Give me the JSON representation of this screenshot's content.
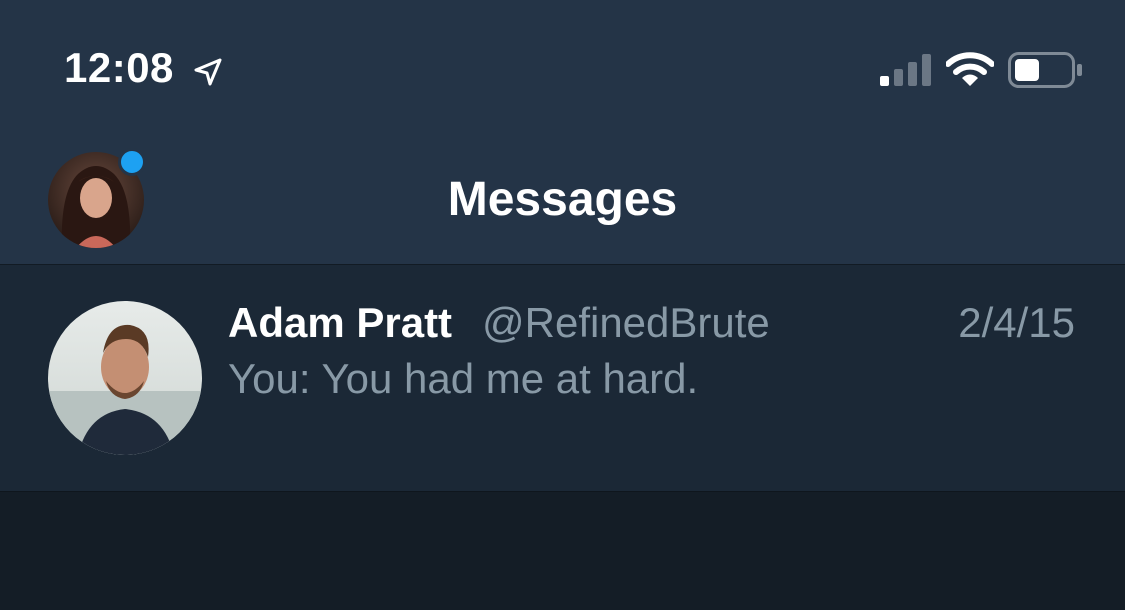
{
  "status_bar": {
    "time": "12:08",
    "icons": [
      "location-arrow-icon",
      "cellular-signal-icon",
      "wifi-icon",
      "battery-icon"
    ]
  },
  "nav": {
    "title": "Messages",
    "avatar_icon": "profile-avatar",
    "unread_indicator": true
  },
  "conversations": [
    {
      "name": "Adam Pratt",
      "handle": "@RefinedBrute",
      "date": "2/4/15",
      "preview": "You: You had me at hard."
    }
  ],
  "colors": {
    "header_bg": "#243447",
    "row_bg": "#1b2836",
    "page_bg": "#141d26",
    "accent": "#1da1f2",
    "secondary_text": "#8899a6"
  }
}
